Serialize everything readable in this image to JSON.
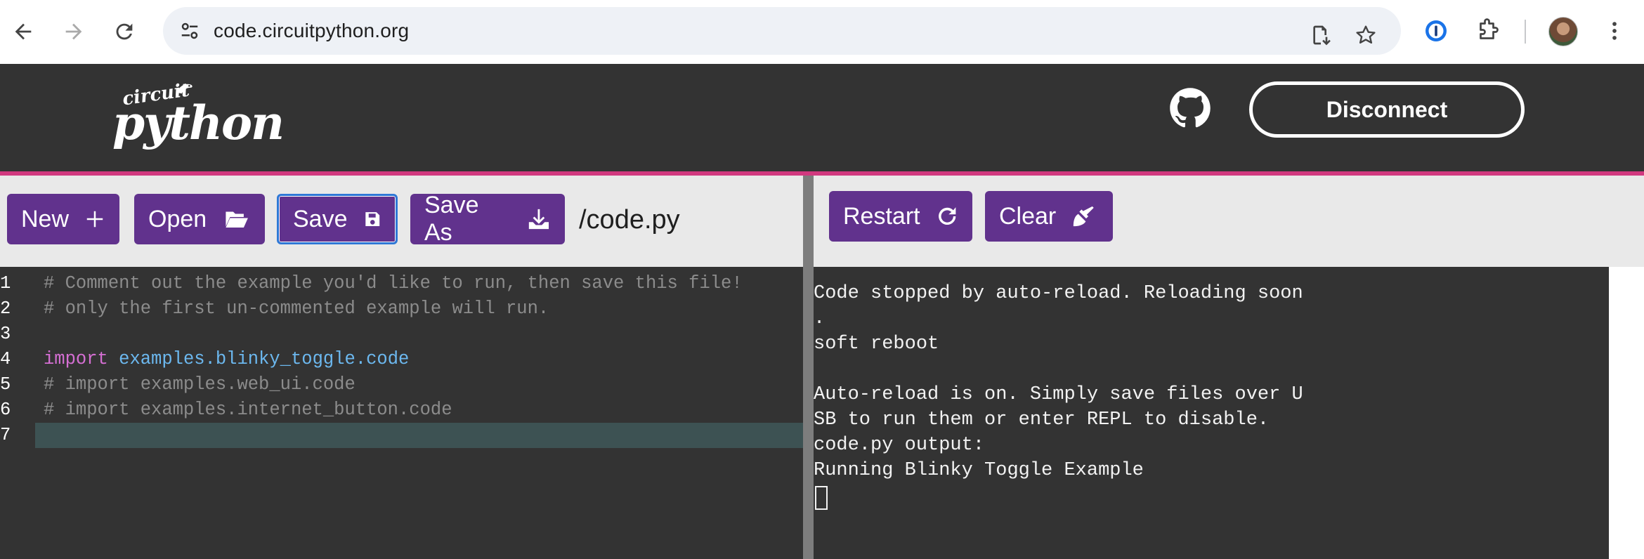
{
  "browser": {
    "url": "code.circuitpython.org",
    "back_icon": "arrow-left-icon",
    "forward_icon": "arrow-right-icon",
    "reload_icon": "reload-icon"
  },
  "header": {
    "logo_small": "circuit",
    "logo_big": "python",
    "disconnect_label": "Disconnect"
  },
  "editor_toolbar": {
    "new_label": "New",
    "open_label": "Open",
    "save_label": "Save",
    "save_as_label": "Save As",
    "filename": "/code.py"
  },
  "terminal_toolbar": {
    "restart_label": "Restart",
    "clear_label": "Clear"
  },
  "editor": {
    "lines": [
      {
        "n": "1",
        "kind": "comment",
        "text": "# Comment out the example you'd like to run, then save this file!"
      },
      {
        "n": "2",
        "kind": "comment",
        "text": "# only the first un-commented example will run."
      },
      {
        "n": "3",
        "kind": "blank",
        "text": ""
      },
      {
        "n": "4",
        "kind": "import",
        "keyword": "import",
        "module": "examples.blinky_toggle.code"
      },
      {
        "n": "5",
        "kind": "comment",
        "text": "# import examples.web_ui.code"
      },
      {
        "n": "6",
        "kind": "comment",
        "text": "# import examples.internet_button.code"
      },
      {
        "n": "7",
        "kind": "blank",
        "text": "",
        "active": true
      }
    ]
  },
  "terminal": {
    "lines": [
      "Code stopped by auto-reload. Reloading soon",
      ".",
      "soft reboot",
      "",
      "Auto-reload is on. Simply save files over U",
      "SB to run them or enter REPL to disable.",
      "code.py output:",
      "Running Blinky Toggle Example"
    ]
  },
  "colors": {
    "button_purple": "#61328d",
    "header_bg": "#333333",
    "accent_stripe": "#d1397f",
    "keyword": "#d56fd3",
    "module": "#6cb8ef",
    "comment": "#8c8c8c"
  }
}
